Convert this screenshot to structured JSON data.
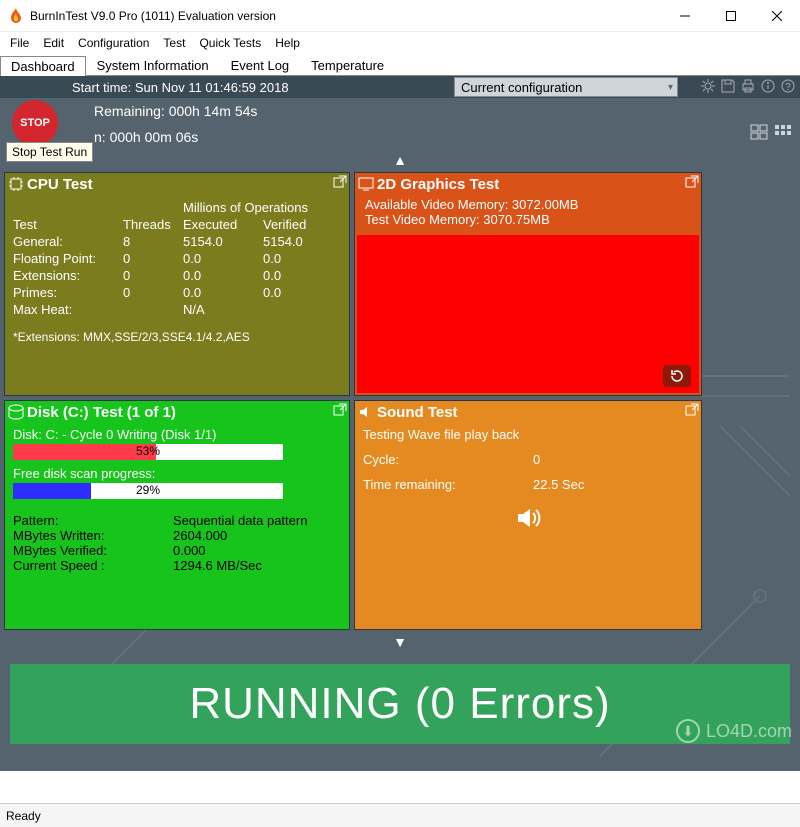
{
  "window": {
    "title": "BurnInTest V9.0 Pro (1011) Evaluation version"
  },
  "menu": [
    "File",
    "Edit",
    "Configuration",
    "Test",
    "Quick Tests",
    "Help"
  ],
  "tabs": [
    "Dashboard",
    "System Information",
    "Event Log",
    "Temperature"
  ],
  "header": {
    "start_time": "Start time: Sun Nov 11 01:46:59 2018",
    "remaining": "Remaining: 000h 14m 54s",
    "elapsed_tail": "n: 000h 00m 06s",
    "dropdown": "Current configuration",
    "stop_label": "STOP",
    "tooltip": "Stop Test Run"
  },
  "cpu": {
    "title": "CPU Test",
    "h_ops": "Millions of Operations",
    "h_test": "Test",
    "h_threads": "Threads",
    "h_exec": "Executed",
    "h_ver": "Verified",
    "rows": [
      {
        "name": "General:",
        "threads": "8",
        "exec": "5154.0",
        "ver": "5154.0"
      },
      {
        "name": "Floating Point:",
        "threads": "0",
        "exec": "0.0",
        "ver": "0.0"
      },
      {
        "name": "Extensions:",
        "threads": "0",
        "exec": "0.0",
        "ver": "0.0"
      },
      {
        "name": "Primes:",
        "threads": "0",
        "exec": "0.0",
        "ver": "0.0"
      },
      {
        "name": "Max Heat:",
        "threads": "",
        "exec": "N/A",
        "ver": ""
      }
    ],
    "note": "*Extensions: MMX,SSE/2/3,SSE4.1/4.2,AES"
  },
  "gfx": {
    "title": "2D Graphics Test",
    "avail": "Available Video Memory: 3072.00MB",
    "test": "Test Video Memory: 3070.75MB"
  },
  "disk": {
    "title": "Disk (C:) Test (1 of 1)",
    "status": "Disk: C: - Cycle 0 Writing (Disk 1/1)",
    "p1_pct": "53%",
    "freescan": "Free disk scan progress:",
    "p2_pct": "29%",
    "pattern_l": "Pattern:",
    "pattern_v": "Sequential data pattern",
    "written_l": "MBytes Written:",
    "written_v": "2604.000",
    "verified_l": "MBytes Verified:",
    "verified_v": "0.000",
    "speed_l": "Current Speed :",
    "speed_v": "1294.6 MB/Sec"
  },
  "sound": {
    "title": "Sound Test",
    "status": "Testing Wave file play back",
    "cycle_l": "Cycle:",
    "cycle_v": "0",
    "time_l": "Time remaining:",
    "time_v": "22.5 Sec"
  },
  "banner": "RUNNING (0 Errors)",
  "statusbar": "Ready",
  "watermark": "LO4D.com"
}
